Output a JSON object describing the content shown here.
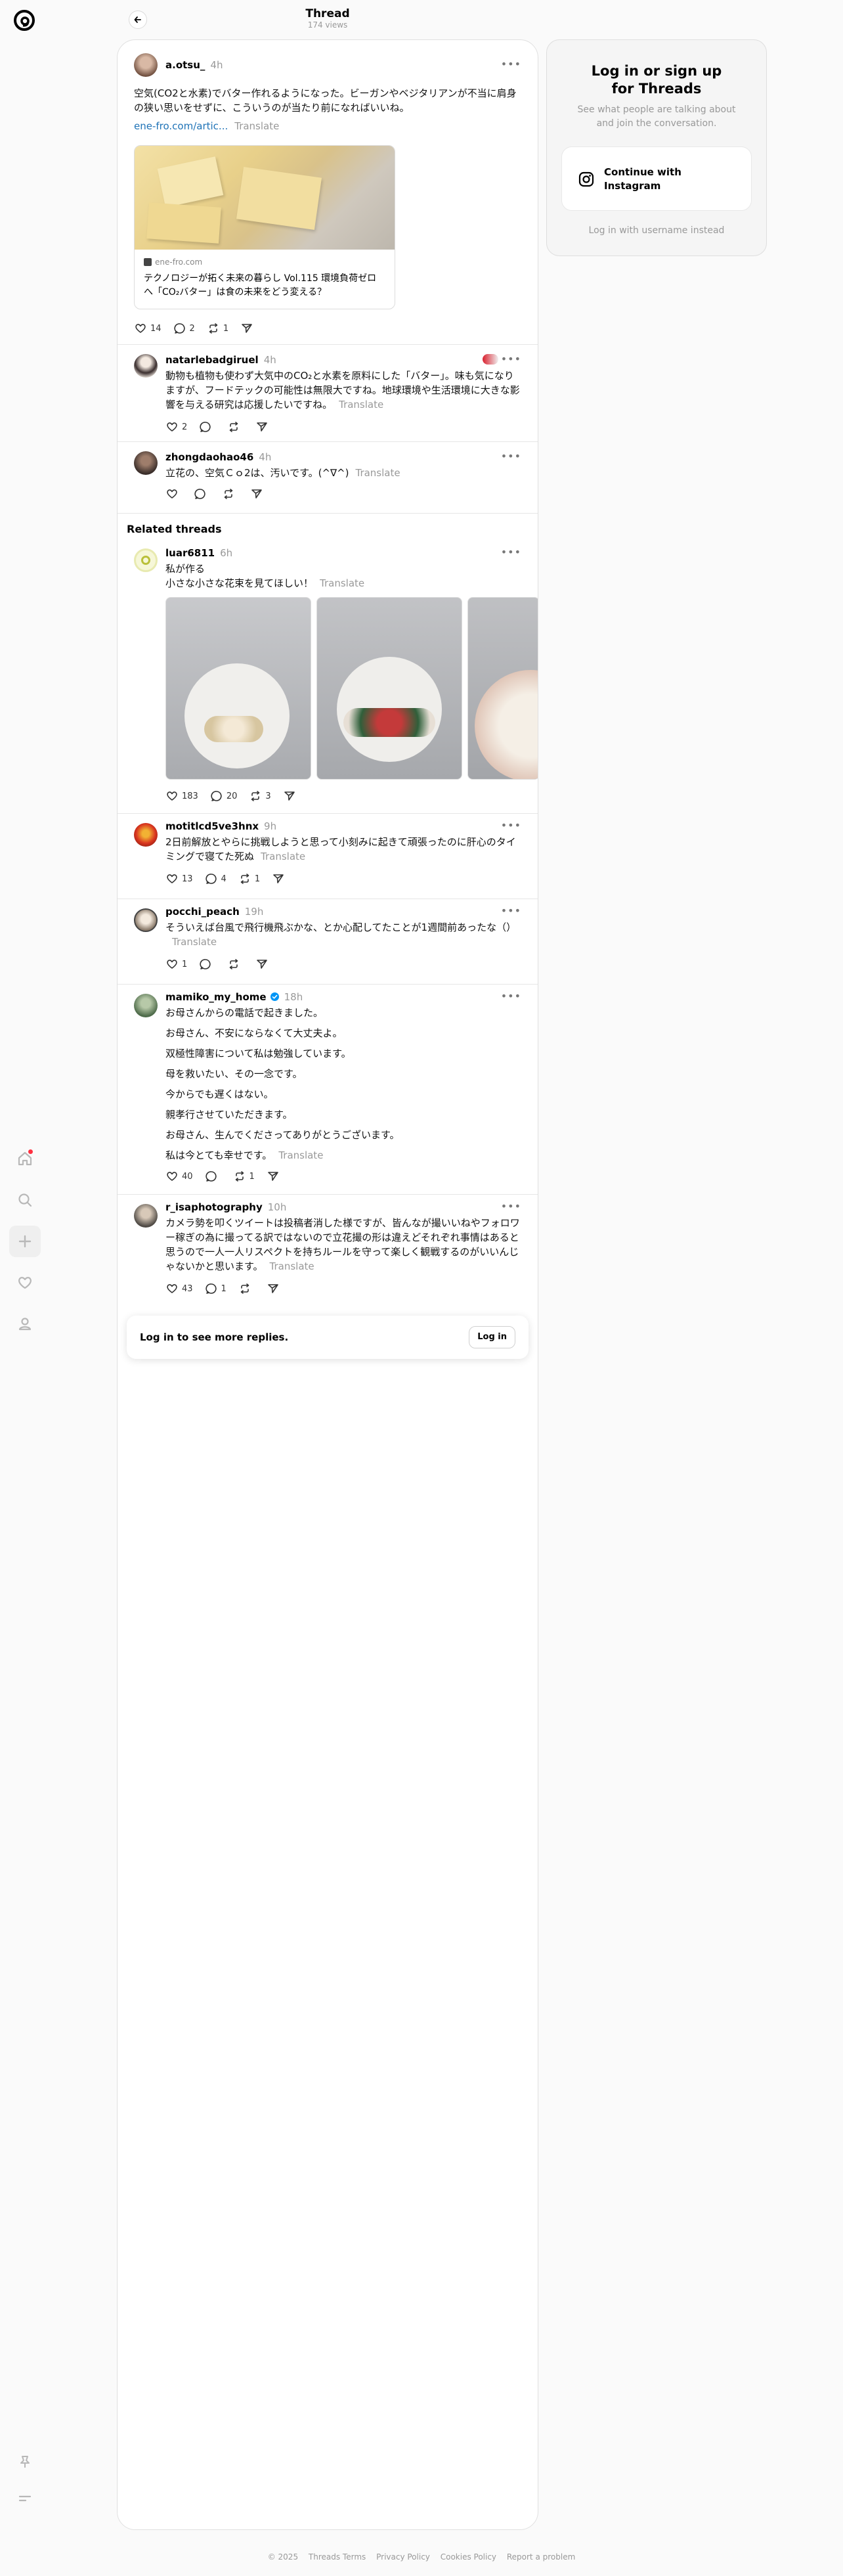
{
  "header": {
    "title": "Thread",
    "views": "174 views"
  },
  "main_post": {
    "username": "a.otsu_",
    "time": "4h",
    "text": "空気(CO2と水素)でバター作れるようになった。ビーガンやベジタリアンが不当に肩身の狭い思いをせずに、こういうのが当たり前になればいいね。",
    "link": "ene-fro.com/artic...",
    "translate": "Translate",
    "card_domain": "ene-fro.com",
    "card_title": "テクノロジーが拓く未来の暮らし Vol.115 環境負荷ゼロへ「CO₂バター」は食の未来をどう変える？",
    "likes": "14",
    "replies": "2",
    "reposts": "1"
  },
  "replies": [
    {
      "username": "natarlebadgiruel",
      "time": "4h",
      "text": "動物も植物も使わず大気中のCO₂と水素を原料にした「バター」。味も気になりますが、フードテックの可能性は無限大ですね。地球環境や生活環境に大きな影響を与える研究は応援したいですね。",
      "translate": "Translate",
      "likes": "2"
    },
    {
      "username": "zhongdaohao46",
      "time": "4h",
      "text": "立花の、空気Ｃｏ2は、汚いです。(^∇^)",
      "translate": "Translate"
    }
  ],
  "related": {
    "heading": "Related threads",
    "posts": [
      {
        "username": "luar6811",
        "time": "6h",
        "text1": "私が作る",
        "text2": "小さな小さな花束を見てほしい！",
        "translate": "Translate",
        "likes": "183",
        "replies": "20",
        "reposts": "3"
      },
      {
        "username": "motitlcd5ve3hnx",
        "time": "9h",
        "text": "2日前解放とやらに挑戦しようと思って小刻みに起きて頑張ったのに肝心のタイミングで寝てた死ぬ",
        "translate": "Translate",
        "likes": "13",
        "replies": "4",
        "reposts": "1"
      },
      {
        "username": "pocchi_peach",
        "time": "19h",
        "text": "そういえば台風で飛行機飛ぶかな、とか心配してたことが1週間前あったな（）",
        "translate": "Translate",
        "likes": "1"
      },
      {
        "username": "mamiko_my_home",
        "time": "18h",
        "lines": [
          "お母さんからの電話で起きました。",
          "お母さん、不安にならなくて大丈夫よ。",
          "双極性障害について私は勉強しています。",
          "母を救いたい、その一念です。",
          "今からでも遅くはない。",
          "親孝行させていただきます。",
          "お母さん、生んでくださってありがとうございます。",
          "私は今とても幸せです。"
        ],
        "translate": "Translate",
        "likes": "40",
        "reposts": "1"
      },
      {
        "username": "r_isaphotography",
        "time": "10h",
        "text": "カメラ勢を叩くツイートは投稿者消した様ですが、皆んなが撮いいねやフォロワー稼ぎの為に撮ってる訳ではないので立花撮の形は違えどそれぞれ事情はあると思うので一人一人リスペクトを持ちルールを守って楽しく観戦するのがいいんじゃないかと思います。",
        "translate": "Translate",
        "likes": "43",
        "replies": "1"
      }
    ]
  },
  "login_bar": {
    "text": "Log in to see more replies.",
    "button": "Log in"
  },
  "login_panel": {
    "title_line1": "Log in or sign up",
    "title_line2": "for Threads",
    "subtitle_line1": "See what people are talking about",
    "subtitle_line2": "and join the conversation.",
    "instagram_line1": "Continue with",
    "instagram_line2": "Instagram",
    "username_link": "Log in with username instead"
  },
  "footer": {
    "copyright": "© 2025",
    "terms": "Threads Terms",
    "privacy": "Privacy Policy",
    "cookies": "Cookies Policy",
    "report": "Report a problem"
  },
  "colors": {
    "link": "#1f73b7",
    "badge": "#0095f6",
    "notification": "#ff3040"
  }
}
